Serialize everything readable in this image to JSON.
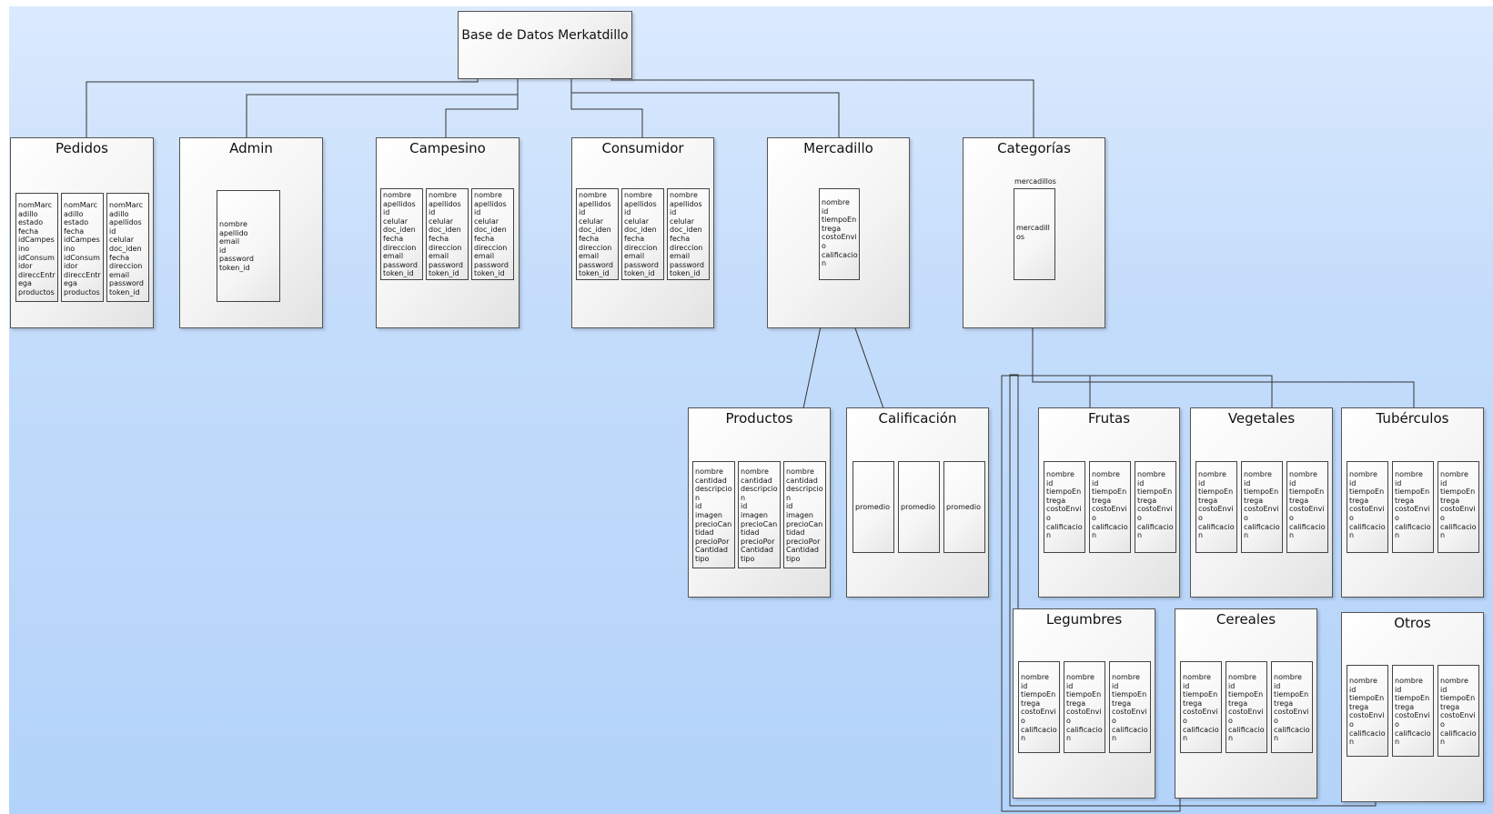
{
  "root": {
    "title": "Base de Datos Merkatdillo"
  },
  "nodes": {
    "pedidos": {
      "title": "Pedidos",
      "fields": [
        "nomMarc\nadillo\nestado\nfecha\nidCampes\nino\nidConsum\nidor\ndireccEntr\nega\nproductos",
        "nomMarc\nadillo\nestado\nfecha\nidCampes\nino\nidConsum\nidor\ndireccEntr\nega\nproductos",
        "nomMarc\nadillo\napellidos\nid\ncelular\ndoc_iden\nfecha\ndireccion\nemail\npassword\ntoken_id"
      ]
    },
    "admin": {
      "title": "Admin",
      "fields": [
        "nombre\napellido\nemail\nid\npassword\ntoken_id"
      ]
    },
    "campesino": {
      "title": "Campesino",
      "fields": [
        "nombre\napellidos\nid\ncelular\ndoc_iden\nfecha\ndireccion\nemail\npassword\ntoken_id",
        "nombre\napellidos\nid\ncelular\ndoc_iden\nfecha\ndireccion\nemail\npassword\ntoken_id",
        "nombre\napellidos\nid\ncelular\ndoc_iden\nfecha\ndireccion\nemail\npassword\ntoken_id"
      ]
    },
    "consumidor": {
      "title": "Consumidor",
      "fields": [
        "nombre\napellidos\nid\ncelular\ndoc_iden\nfecha\ndireccion\nemail\npassword\ntoken_id",
        "nombre\napellidos\nid\ncelular\ndoc_iden\nfecha\ndireccion\nemail\npassword\ntoken_id",
        "nombre\napellidos\nid\ncelular\ndoc_iden\nfecha\ndireccion\nemail\npassword\ntoken_id"
      ]
    },
    "mercadillo": {
      "title": "Mercadillo",
      "fields": [
        "nombre\nid\ntiempoEn\ntrega\ncostoEnvi\no\ncalificacio\nn"
      ]
    },
    "categorias": {
      "title": "Categorías",
      "caption": "mercadillos",
      "fields": [
        "mercadill\nos"
      ]
    },
    "productos": {
      "title": "Productos",
      "fields": [
        "nombre\ncantidad\ndescripcio\nn\nid\nimagen\nprecioCan\ntidad\nprecioPor\nCantidad\ntipo",
        "nombre\ncantidad\ndescripcio\nn\nid\nimagen\nprecioCan\ntidad\nprecioPor\nCantidad\ntipo",
        "nombre\ncantidad\ndescripcio\nn\nid\nimagen\nprecioCan\ntidad\nprecioPor\nCantidad\ntipo"
      ]
    },
    "calificacion": {
      "title": "Calificación",
      "fields": [
        "promedio",
        "promedio",
        "promedio"
      ]
    },
    "frutas": {
      "title": "Frutas",
      "fields": [
        "nombre\nid\ntiempoEn\ntrega\ncostoEnvi\no\ncalificacio\nn",
        "nombre\nid\ntiempoEn\ntrega\ncostoEnvi\no\ncalificacio\nn",
        "nombre\nid\ntiempoEn\ntrega\ncostoEnvi\no\ncalificacio\nn"
      ]
    },
    "vegetales": {
      "title": "Vegetales",
      "fields": [
        "nombre\nid\ntiempoEn\ntrega\ncostoEnvi\no\ncalificacio\nn",
        "nombre\nid\ntiempoEn\ntrega\ncostoEnvi\no\ncalificacio\nn",
        "nombre\nid\ntiempoEn\ntrega\ncostoEnvi\no\ncalificacio\nn"
      ]
    },
    "tuberculos": {
      "title": "Tubérculos",
      "fields": [
        "nombre\nid\ntiempoEn\ntrega\ncostoEnvi\no\ncalificacio\nn",
        "nombre\nid\ntiempoEn\ntrega\ncostoEnvi\no\ncalificacio\nn",
        "nombre\nid\ntiempoEn\ntrega\ncostoEnvi\no\ncalificacio\nn"
      ]
    },
    "legumbres": {
      "title": "Legumbres",
      "fields": [
        "nombre\nid\ntiempoEn\ntrega\ncostoEnvi\no\ncalificacio\nn",
        "nombre\nid\ntiempoEn\ntrega\ncostoEnvi\no\ncalificacio\nn",
        "nombre\nid\ntiempoEn\ntrega\ncostoEnvi\no\ncalificacio\nn"
      ]
    },
    "cereales": {
      "title": "Cereales",
      "fields": [
        "nombre\nid\ntiempoEn\ntrega\ncostoEnvi\no\ncalificacio\nn",
        "nombre\nid\ntiempoEn\ntrega\ncostoEnvi\no\ncalificacio\nn",
        "nombre\nid\ntiempoEn\ntrega\ncostoEnvi\no\ncalificacio\nn"
      ]
    },
    "otros": {
      "title": "Otros",
      "fields": [
        "nombre\nid\ntiempoEn\ntrega\ncostoEnvi\no\ncalificacio\nn",
        "nombre\nid\ntiempoEn\ntrega\ncostoEnvi\no\ncalificacio\nn",
        "nombre\nid\ntiempoEn\ntrega\ncostoEnvi\no\ncalificacio\nn"
      ]
    }
  }
}
